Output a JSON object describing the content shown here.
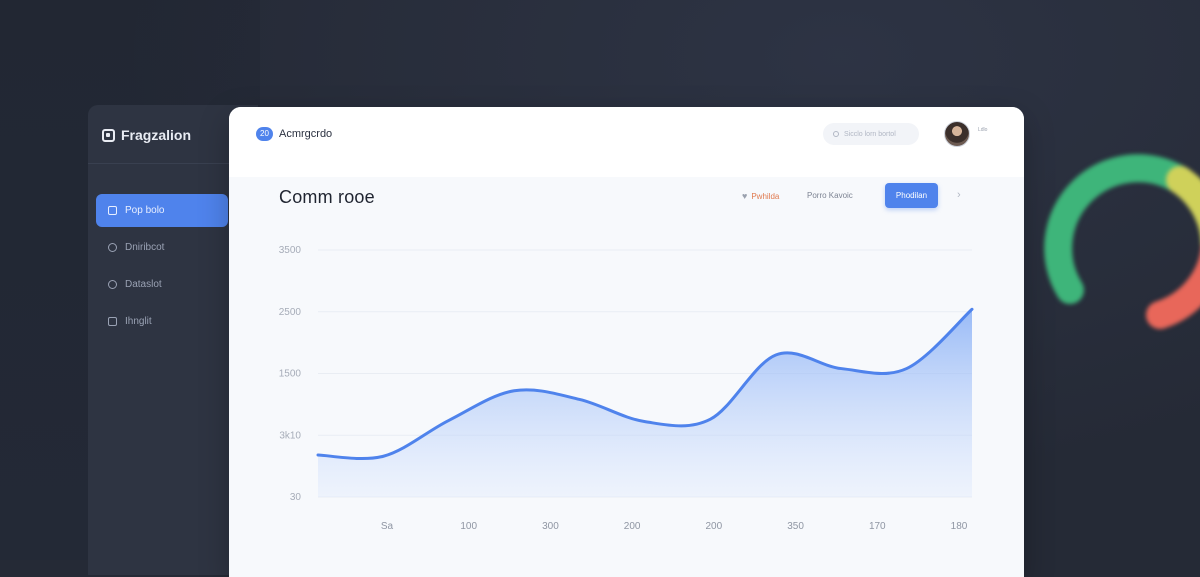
{
  "sidebar": {
    "brand": "Fragzalion",
    "items": [
      {
        "label": "Pop bolo",
        "icon": "grid-icon"
      },
      {
        "label": "Dniribcot",
        "icon": "circle-icon"
      },
      {
        "label": "Dataslot",
        "icon": "circle-icon"
      },
      {
        "label": "Ihnglit",
        "icon": "square-icon"
      }
    ]
  },
  "topbar": {
    "app_name": "Acmrgcrdo",
    "logo_text": "20",
    "search_placeholder": "Sicclo lorn bortol",
    "avatar_label": "Ldlo"
  },
  "main": {
    "title": "Comm rooe",
    "filter_one": "Pwhilda",
    "filter_two": "Porro Kavoic",
    "primary_button": "Phodilan",
    "more_glyph": "›"
  },
  "chart_data": {
    "type": "area",
    "title": "",
    "xlabel": "",
    "ylabel": "",
    "y_tick_labels": [
      "3500",
      "2500",
      "1500",
      "3k10",
      "30"
    ],
    "x_tick_labels": [
      "Sa",
      "100",
      "300",
      "200",
      "200",
      "350",
      "170",
      "180"
    ],
    "x": [
      0,
      0.1,
      0.2,
      0.3,
      0.4,
      0.5,
      0.6,
      0.7,
      0.8,
      0.9,
      1
    ],
    "series": [
      {
        "values": [
          0.34,
          0.33,
          0.62,
          0.86,
          0.79,
          0.61,
          0.63,
          1.15,
          1.04,
          1.04,
          1.52
        ],
        "values_note": "",
        "color": "#4f83ec"
      }
    ],
    "ylim": [
      0,
      2
    ],
    "grid": true
  }
}
